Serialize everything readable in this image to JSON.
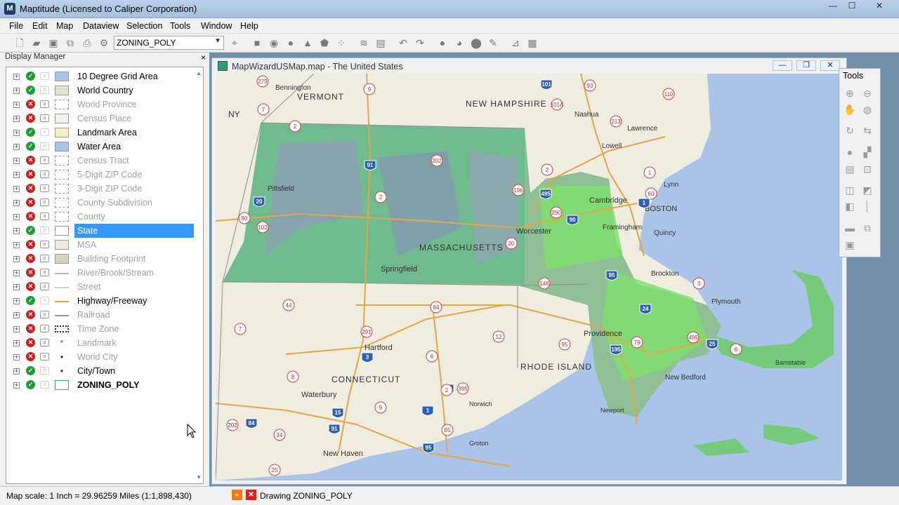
{
  "window": {
    "title": "Maptitude (Licensed to Caliper Corporation)",
    "minimize": "—",
    "maximize": "☐",
    "close": "✕"
  },
  "menu": [
    "File",
    "Edit",
    "Map",
    "Dataview",
    "Selection",
    "Tools",
    "Window",
    "Help"
  ],
  "toolbar": {
    "layer_select": "ZONING_POLY"
  },
  "display_manager": {
    "title": "Display Manager",
    "close": "×",
    "layers": [
      {
        "name": "10 Degree Grid Area",
        "visible": true,
        "dim": false,
        "swatch": "#a9c4ea",
        "selected": false
      },
      {
        "name": "World Country",
        "visible": true,
        "dim": false,
        "swatch": "#e4e0cf",
        "selected": false
      },
      {
        "name": "World Province",
        "visible": false,
        "dim": true,
        "swatch": "#ffffff",
        "selected": false
      },
      {
        "name": "Census Place",
        "visible": false,
        "dim": true,
        "swatch": "#f3f3ea",
        "selected": false
      },
      {
        "name": "Landmark Area",
        "visible": true,
        "dim": false,
        "swatch": "#f6efc2",
        "selected": false
      },
      {
        "name": "Water Area",
        "visible": true,
        "dim": false,
        "swatch": "#a9c4ea",
        "selected": false
      },
      {
        "name": "Census Tract",
        "visible": false,
        "dim": true,
        "swatch": "#ffffff",
        "selected": false
      },
      {
        "name": "5-Digit ZIP Code",
        "visible": false,
        "dim": true,
        "swatch": "#ffffff",
        "selected": false
      },
      {
        "name": "3-Digit ZIP Code",
        "visible": false,
        "dim": true,
        "swatch": "#ffffff",
        "selected": false
      },
      {
        "name": "County Subdivision",
        "visible": false,
        "dim": true,
        "swatch": "#ffffff",
        "selected": false
      },
      {
        "name": "County",
        "visible": false,
        "dim": true,
        "swatch": "#ffffff",
        "selected": false
      },
      {
        "name": "State",
        "visible": true,
        "dim": false,
        "swatch": "#ffffff",
        "selected": true
      },
      {
        "name": "MSA",
        "visible": false,
        "dim": true,
        "swatch": "#f4e8e0",
        "selected": false
      },
      {
        "name": "Building Footprint",
        "visible": false,
        "dim": true,
        "swatch": "#d8d2c0",
        "selected": false
      },
      {
        "name": "River/Brook/Stream",
        "visible": false,
        "dim": true,
        "swatch": "line:#9fb6d6",
        "selected": false
      },
      {
        "name": "Street",
        "visible": false,
        "dim": true,
        "swatch": "line:#cccccc",
        "selected": false
      },
      {
        "name": "Highway/Freeway",
        "visible": true,
        "dim": false,
        "swatch": "line:#d8a826",
        "selected": false
      },
      {
        "name": "Railroad",
        "visible": false,
        "dim": true,
        "swatch": "line:#999999",
        "selected": false
      },
      {
        "name": "Time Zone",
        "visible": false,
        "dim": true,
        "swatch": "dash:#333333",
        "selected": false
      },
      {
        "name": "Landmark",
        "visible": false,
        "dim": true,
        "swatch": "star:#555555",
        "selected": false
      },
      {
        "name": "World City",
        "visible": false,
        "dim": true,
        "swatch": "dot:#222222",
        "selected": false
      },
      {
        "name": "City/Town",
        "visible": true,
        "dim": false,
        "swatch": "dot:#222222",
        "selected": false
      },
      {
        "name": "ZONING_POLY",
        "visible": true,
        "dim": false,
        "swatch": "box:#3cb84a",
        "selected": false,
        "bold": true
      }
    ]
  },
  "map_window": {
    "title": "MapWizardUSMap.map - The United States",
    "states": [
      "VERMONT",
      "NEW HAMPSHIRE",
      "MASSACHUSETTS",
      "CONNECTICUT",
      "RHODE ISLAND",
      "NY"
    ],
    "cities": [
      "Bennington",
      "Nashua",
      "Lawrence",
      "Lowell",
      "Lynn",
      "Cambridge",
      "BOSTON",
      "Quincy",
      "Pittsfield",
      "Worcester",
      "Framingham",
      "Springfield",
      "Brockton",
      "Plymouth",
      "Providence",
      "Hartford",
      "New Bedford",
      "Barnstable",
      "Waterbury",
      "Norwich",
      "Newport",
      "New Haven",
      "Groton"
    ],
    "route_shields": [
      "279",
      "9",
      "101",
      "93",
      "2",
      "7",
      "101A",
      "213",
      "110",
      "2",
      "91",
      "202",
      "1",
      "2",
      "196",
      "495",
      "60",
      "20",
      "290",
      "90",
      "90",
      "102",
      "20",
      "1",
      "146",
      "95",
      "3",
      "44",
      "84",
      "24",
      "7",
      "291",
      "2",
      "12",
      "95",
      "195",
      "79",
      "495",
      "25",
      "6",
      "3",
      "6",
      "8",
      "2",
      "395",
      "9",
      "15",
      "1",
      "202",
      "84",
      "34",
      "91",
      "85",
      "95",
      "25"
    ]
  },
  "tools": {
    "title": "Tools"
  },
  "status": {
    "scale": "Map scale: 1 Inch = 29.96259 Miles (1:1,898,430)",
    "drawing": "Drawing ZONING_POLY"
  }
}
